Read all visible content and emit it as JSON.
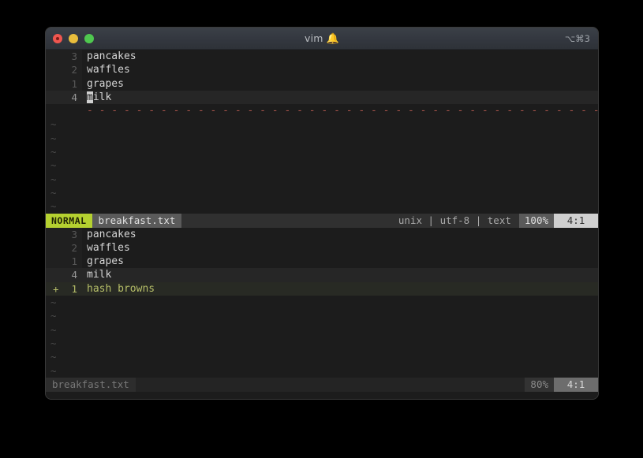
{
  "window": {
    "title": "vim",
    "title_icon": "bell-icon",
    "bell_glyph": "🔔",
    "shortcut_badge": "⌥⌘3",
    "traffic_lights": [
      {
        "name": "close",
        "color": "#f0564f"
      },
      {
        "name": "minimize",
        "color": "#e8bd3c"
      },
      {
        "name": "maximize",
        "color": "#4fc84f"
      }
    ]
  },
  "theme": {
    "background": "#1c1c1c",
    "gutter_bg": "#202020",
    "mode_accent": "#b5d130",
    "diff_add": "#b5bd68",
    "diff_sep": "#a5534a",
    "cursor": "#d0d0d0"
  },
  "panes": [
    {
      "name": "top-pane",
      "lines": [
        {
          "gutter": "3",
          "text": "pancakes",
          "kind": "normal"
        },
        {
          "gutter": "2",
          "text": "waffles",
          "kind": "normal"
        },
        {
          "gutter": "1",
          "text": "grapes",
          "kind": "normal"
        },
        {
          "gutter": "4",
          "text": "milk",
          "kind": "cursor",
          "cursor_char": "m",
          "cursor_rest": "ilk"
        },
        {
          "gutter": "",
          "text": "-",
          "kind": "dashes"
        }
      ],
      "filler_count": 7,
      "filler_glyph": "~",
      "status": {
        "mode": "NORMAL",
        "file": "breakfast.txt",
        "fileformat": "unix",
        "encoding": "utf-8",
        "filetype": "text",
        "separator": "|",
        "percent": "100%",
        "position": "4:1",
        "active": true
      }
    },
    {
      "name": "bottom-pane",
      "lines": [
        {
          "gutter": "3",
          "text": "pancakes",
          "kind": "normal"
        },
        {
          "gutter": "2",
          "text": "waffles",
          "kind": "normal"
        },
        {
          "gutter": "1",
          "text": "grapes",
          "kind": "normal"
        },
        {
          "gutter": "4",
          "text": "milk",
          "kind": "current"
        },
        {
          "gutter": "1",
          "sign": "+",
          "text": "hash browns",
          "kind": "added"
        }
      ],
      "filler_count": 6,
      "filler_glyph": "~",
      "status": {
        "mode": "",
        "file": "breakfast.txt",
        "fileformat": "",
        "encoding": "",
        "filetype": "",
        "separator": "",
        "percent": "80%",
        "position": "4:1",
        "active": false
      }
    }
  ]
}
